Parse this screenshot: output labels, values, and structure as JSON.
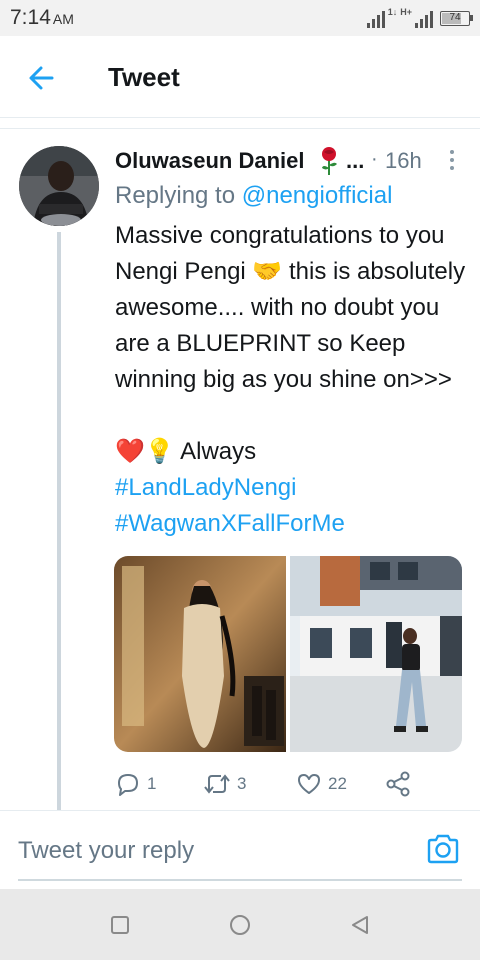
{
  "status_bar": {
    "time": "7:14",
    "ampm": "AM",
    "network_label": "H+",
    "battery": "74",
    "battery_level": 0.74
  },
  "header": {
    "title": "Tweet"
  },
  "tweet": {
    "author_name": "Oluwaseun Daniel",
    "ellipsis": "...",
    "dot": "·",
    "time_ago": "16h",
    "replying_prefix": "Replying to ",
    "replying_handle": "@nengiofficial",
    "body": "Massive congratulations to you Nengi Pengi 🤝 this is absolutely awesome.... with no doubt you are a BLUEPRINT so Keep winning big as you shine on>>>",
    "emoji_line": "❤️💡 Always",
    "hashtag_1": "#LandLadyNengi",
    "hashtag_2": "#WagwanXFallForMe",
    "replies_count": "1",
    "retweets_count": "3",
    "likes_count": "22"
  },
  "reply_bar": {
    "placeholder": "Tweet your reply"
  },
  "colors": {
    "accent": "#1da1f2",
    "secondary_text": "#657786",
    "divider": "#e6ecf0"
  },
  "icons": {
    "back": "arrow-left-icon",
    "more": "more-vertical-icon",
    "reply": "reply-icon",
    "retweet": "retweet-icon",
    "like": "heart-icon",
    "share": "share-icon",
    "camera": "camera-icon",
    "nav_recents": "square-icon",
    "nav_home": "circle-icon",
    "nav_back": "triangle-back-icon"
  }
}
